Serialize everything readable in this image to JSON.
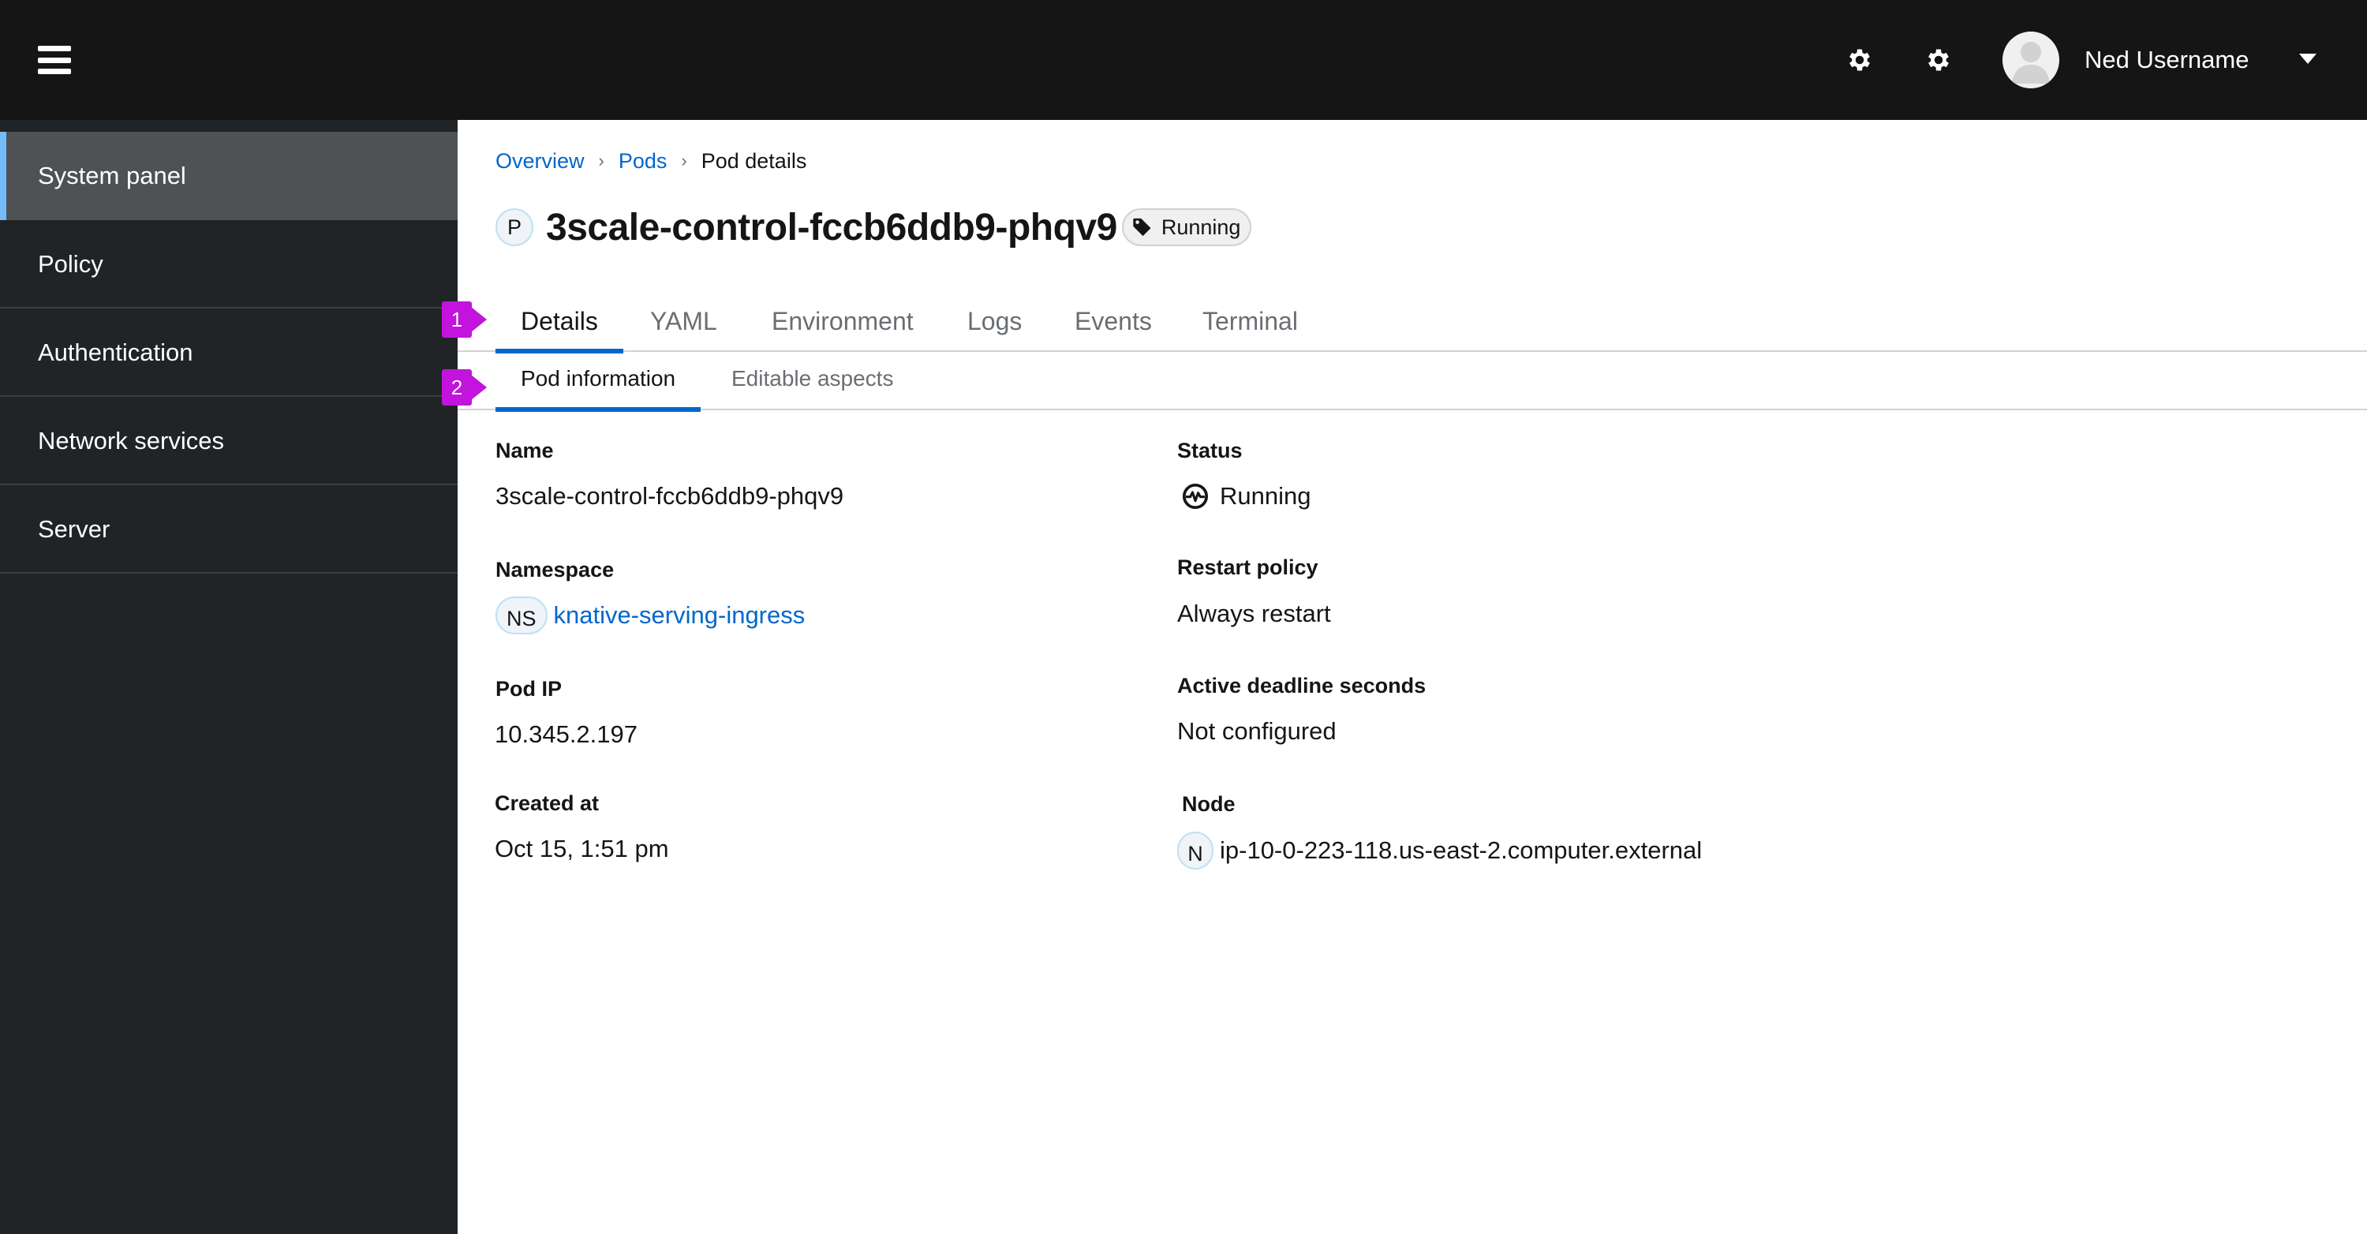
{
  "masthead": {
    "menu_icon": "hamburger-icon",
    "actions": [
      {
        "icon": "gear-icon",
        "label": "Settings"
      },
      {
        "icon": "gear-icon",
        "label": "Settings"
      }
    ],
    "user": {
      "name": "Ned Username",
      "avatar_icon": "user-avatar-icon",
      "dropdown_icon": "caret-down-icon"
    }
  },
  "sidebar": {
    "items": [
      {
        "label": "System panel",
        "active": true
      },
      {
        "label": "Policy",
        "active": false
      },
      {
        "label": "Authentication",
        "active": false
      },
      {
        "label": "Network services",
        "active": false
      },
      {
        "label": "Server",
        "active": false
      }
    ]
  },
  "breadcrumb": {
    "items": [
      {
        "label": "Overview",
        "link": true
      },
      {
        "label": "Pods",
        "link": true
      },
      {
        "label": "Pod details",
        "link": false
      }
    ],
    "separator_icon": "angle-right-icon"
  },
  "header": {
    "resource_badge": "P",
    "title": "3scale-control-fccb6ddb9-phqv9",
    "status_label": "Running",
    "status_label_icon": "tag-icon"
  },
  "tabs": {
    "items": [
      "Details",
      "YAML",
      "Environment",
      "Logs",
      "Events",
      "Terminal"
    ],
    "active": "Details"
  },
  "subtabs": {
    "items": [
      "Pod information",
      "Editable aspects"
    ],
    "active": "Pod information"
  },
  "callouts": [
    "1",
    "2"
  ],
  "details": {
    "left": [
      {
        "label": "Name",
        "value": "3scale-control-fccb6ddb9-phqv9"
      },
      {
        "label": "Namespace",
        "badge": "NS",
        "value": "knative-serving-ingress",
        "link": true
      },
      {
        "label": "Pod IP",
        "value": "10.345.2.197"
      },
      {
        "label": "Created at",
        "value": "Oct 15, 1:51 pm"
      }
    ],
    "right": [
      {
        "label": "Status",
        "icon": "heartbeat-icon",
        "value": "Running"
      },
      {
        "label": "Restart policy",
        "value": "Always restart"
      },
      {
        "label": "Active deadline seconds",
        "value": "Not configured"
      },
      {
        "label": "Node",
        "badge": "N",
        "value": "ip-10-0-223-118.us-east-2.computer.external"
      }
    ]
  },
  "colors": {
    "masthead_bg": "#151515",
    "sidebar_bg": "#212427",
    "sidebar_active_bg": "#4f5255",
    "sidebar_active_accent": "#73bcf7",
    "link": "#0066cc",
    "tab_active_underline": "#0066cc",
    "callout": "#c214dc"
  }
}
